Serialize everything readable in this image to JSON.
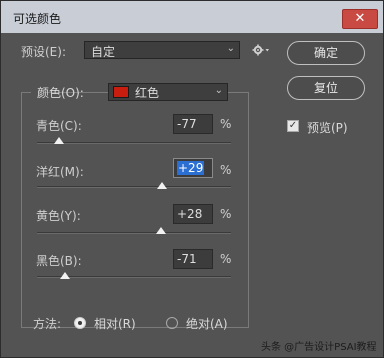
{
  "window": {
    "title": "可选颜色",
    "close_glyph": "✕"
  },
  "preset": {
    "label": "预设(E):",
    "value": "自定"
  },
  "buttons": {
    "ok": "确定",
    "reset": "复位"
  },
  "preview": {
    "label": "预览(P)",
    "checked": true
  },
  "colors": {
    "label": "颜色(O):",
    "value": "红色",
    "swatch_color": "#c91d0f"
  },
  "sliders": [
    {
      "label": "青色(C):",
      "value": "-77",
      "unit": "%",
      "level_pct": -77
    },
    {
      "label": "洋红(M):",
      "value": "+29",
      "unit": "%",
      "level_pct": 29,
      "focused": true
    },
    {
      "label": "黄色(Y):",
      "value": "+28",
      "unit": "%",
      "level_pct": 28
    },
    {
      "label": "黑色(B):",
      "value": "-71",
      "unit": "%",
      "level_pct": -71
    }
  ],
  "method": {
    "label": "方法:",
    "options": [
      {
        "label": "相对(R)",
        "selected": true
      },
      {
        "label": "绝对(A)",
        "selected": false
      }
    ]
  },
  "watermark": "头条 @广告设计PSAI教程",
  "icons": {
    "gear": "gear-icon",
    "dropdown": "chevron-down-icon"
  }
}
